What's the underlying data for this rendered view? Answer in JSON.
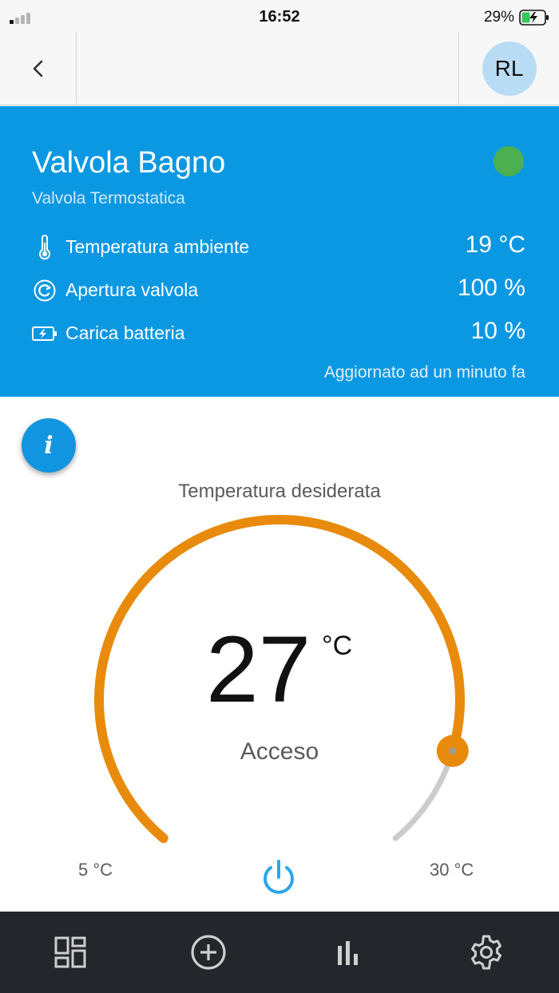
{
  "status_bar": {
    "time": "16:52",
    "battery_percent": "29%"
  },
  "header": {
    "back_icon": "chevron-left-icon",
    "avatar_initials": "RL"
  },
  "device": {
    "title": "Valvola Bagno",
    "subtitle": "Valvola Termostatica",
    "status_color": "#4caf50",
    "metrics": [
      {
        "icon": "thermometer-icon",
        "label": "Temperatura ambiente",
        "value": "19 °C"
      },
      {
        "icon": "valve-opening-icon",
        "label": "Apertura valvola",
        "value": "100 %"
      },
      {
        "icon": "battery-charging-icon",
        "label": "Carica batteria",
        "value": "10 %"
      }
    ],
    "updated": "Aggiornato ad un minuto fa"
  },
  "info_button": {
    "label": "i"
  },
  "thermostat": {
    "label": "Temperatura desiderata",
    "value": "27",
    "unit": "°C",
    "state": "Acceso",
    "min_label": "5 °C",
    "max_label": "30 °C",
    "min": 5,
    "max": 30,
    "setpoint": 27,
    "active_color": "#e88a0b",
    "track_color": "#cccccc"
  },
  "bottom_nav": {
    "items": [
      {
        "icon": "dashboard-icon"
      },
      {
        "icon": "add-circle-icon"
      },
      {
        "icon": "bar-chart-icon"
      },
      {
        "icon": "settings-gear-icon"
      }
    ]
  },
  "colors": {
    "accent_blue": "#0b98e3",
    "nav_dark": "#24262b"
  }
}
